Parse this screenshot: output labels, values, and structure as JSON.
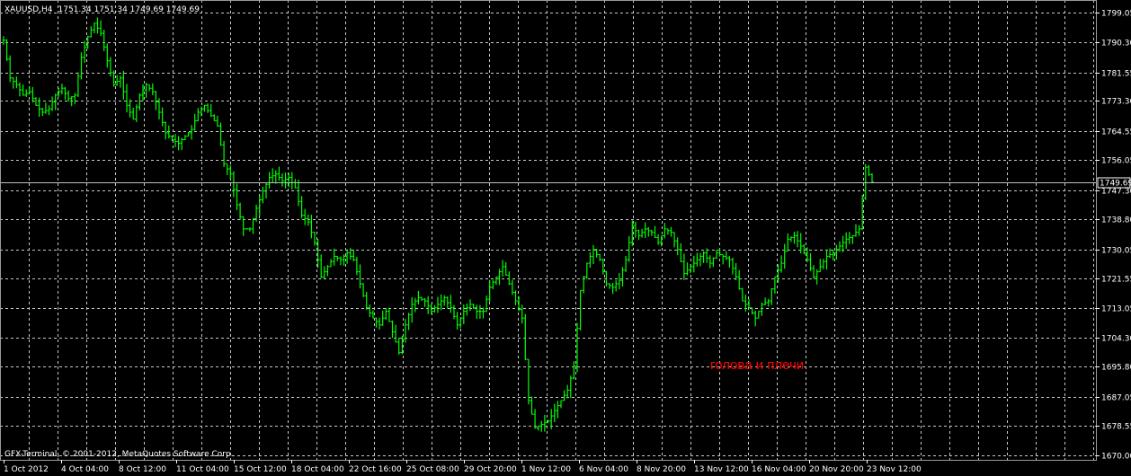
{
  "chart_info": {
    "symbol": "XAUUSD,H4",
    "ohlc": "1751.34 1751.34 1749.69 1749.69",
    "copyright": "GFX-Terminal, © 2001-2012, MetaQuotes Software Corp.",
    "annotation": "голова и плечи",
    "current_price_label": "1749.69"
  },
  "colors": {
    "background": "#000000",
    "grid": "#c8c8c8",
    "bars": "#00ff00",
    "price_line": "#c0c0c0",
    "annotation": "#ff0000",
    "text": "#ffffff"
  },
  "chart_data": {
    "type": "ohlc",
    "ylim": [
      1670.0,
      1801.0
    ],
    "y_ticks": [
      "1799.05",
      "1790.30",
      "1781.55",
      "1773.30",
      "1764.55",
      "1756.05",
      "1747.30",
      "1738.80",
      "1730.05",
      "1721.55",
      "1713.05",
      "1704.30",
      "1695.80",
      "1687.05",
      "1678.55",
      "1670.00"
    ],
    "x_ticks": [
      "1 Oct 2012",
      "4 Oct 04:00",
      "8 Oct 12:00",
      "11 Oct 04:00",
      "15 Oct 12:00",
      "18 Oct 04:00",
      "22 Oct 16:00",
      "25 Oct 08:00",
      "29 Oct 20:00",
      "1 Nov 12:00",
      "6 Nov 04:00",
      "8 Nov 20:00",
      "13 Nov 12:00",
      "16 Nov 04:00",
      "20 Nov 20:00",
      "23 Nov 12:00"
    ],
    "current_price": 1749.69,
    "closes": [
      1791,
      1780,
      1778,
      1775,
      1776,
      1772,
      1770,
      1771,
      1775,
      1777,
      1774,
      1775,
      1786,
      1792,
      1796,
      1793,
      1785,
      1778,
      1780,
      1772,
      1768,
      1775,
      1778,
      1776,
      1770,
      1764,
      1762,
      1761,
      1763,
      1765,
      1770,
      1772,
      1769,
      1766,
      1755,
      1752,
      1743,
      1736,
      1736,
      1742,
      1747,
      1751,
      1752,
      1750,
      1751,
      1748,
      1740,
      1738,
      1732,
      1722,
      1725,
      1728,
      1727,
      1729,
      1727,
      1720,
      1713,
      1710,
      1708,
      1712,
      1706,
      1700,
      1708,
      1714,
      1716,
      1715,
      1712,
      1714,
      1716,
      1713,
      1708,
      1712,
      1714,
      1712,
      1712,
      1719,
      1722,
      1725,
      1720,
      1715,
      1710,
      1686,
      1678,
      1679,
      1680,
      1683,
      1686,
      1689,
      1696,
      1718,
      1726,
      1730,
      1727,
      1720,
      1719,
      1721,
      1727,
      1737,
      1734,
      1736,
      1735,
      1732,
      1736,
      1735,
      1730,
      1723,
      1725,
      1727,
      1729,
      1726,
      1729,
      1728,
      1727,
      1722,
      1715,
      1713,
      1710,
      1714,
      1715,
      1722,
      1726,
      1733,
      1734,
      1731,
      1727,
      1722,
      1725,
      1728,
      1729,
      1731,
      1733,
      1734,
      1736,
      1754,
      1749.69
    ]
  }
}
